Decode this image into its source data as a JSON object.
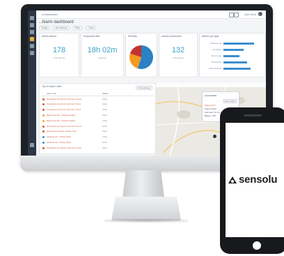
{
  "topbar": {
    "crumb": "◂ Dashboard",
    "user": "John Doe"
  },
  "page": {
    "title": "Alarm dashboard",
    "filters": [
      "Today",
      "All trackers",
      "Filter",
      "Clear"
    ]
  },
  "cards": [
    {
      "title": "Active alarms",
      "value": "178",
      "sub": "Total alarms"
    },
    {
      "title": "Response time",
      "value": "18h 02m",
      "sub": "Average"
    },
    {
      "title": "Severity",
      "value": "",
      "sub": ""
    },
    {
      "title": "Assets unresolved",
      "value": "132",
      "sub": "Total assets"
    },
    {
      "title": "Alarms per type",
      "value": "",
      "sub": ""
    }
  ],
  "severity_chart": {
    "type": "pie",
    "slices": [
      {
        "label": "Critical",
        "value": 55,
        "color": "#2a82c4"
      },
      {
        "label": "Warning",
        "value": 25,
        "color": "#f39a1e"
      },
      {
        "label": "Info",
        "value": 20,
        "color": "#c4322f"
      }
    ]
  },
  "alarm_types": {
    "labels": [
      "Geofence exit",
      "Low battery",
      "Out of range",
      "Temperature",
      "Shock detected"
    ],
    "values": [
      0.85,
      0.55,
      0.45,
      0.65,
      0.75
    ]
  },
  "table": {
    "title": "Top 10 alarm sites",
    "ack_label": "Acknowledge",
    "headers": [
      "Alarm site",
      "Status"
    ],
    "rows": [
      {
        "site": "Temperature too high for more than 4 hours",
        "status": "Active",
        "icon_color": "#d05a37"
      },
      {
        "site": "Temperature too low for more than 4 hours",
        "status": "Active",
        "icon_color": "#d05a37"
      },
      {
        "site": "Temperature too low for more than 4 hours",
        "status": "Active",
        "icon_color": "#d05a37"
      },
      {
        "site": "Battery level low - recharge needed",
        "status": "Active",
        "icon_color": "#e9b03e"
      },
      {
        "site": "Battery level low - recharge needed",
        "status": "Active",
        "icon_color": "#e9b03e"
      },
      {
        "site": "Temperature too high for more than 4 hours",
        "status": "Active",
        "icon_color": "#d05a37"
      },
      {
        "site": "Temperature too high - location: Gent",
        "status": "Active",
        "icon_color": "#d05a37"
      },
      {
        "site": "Geofence exit - Antwerp depot",
        "status": "Active",
        "icon_color": "#3b8fd0"
      },
      {
        "site": "Geofence exit - Antwerp depot",
        "status": "Active",
        "icon_color": "#3b8fd0"
      },
      {
        "site": "Temperature too high for more than 4 hours",
        "status": "Active",
        "icon_color": "#d05a37"
      }
    ]
  },
  "map": {
    "popup_title": "Last location",
    "popup_button": "View tracker",
    "popup_lines": [
      "Pallet #1274",
      "Status: Active",
      "Last seen: 10 min ago",
      "Battery: 78%"
    ]
  },
  "phone": {
    "brand": "sensolu"
  },
  "colors": {
    "accent": "#3aa0c8",
    "sidebar": "#2d3644",
    "alarm": "#d05a37"
  }
}
